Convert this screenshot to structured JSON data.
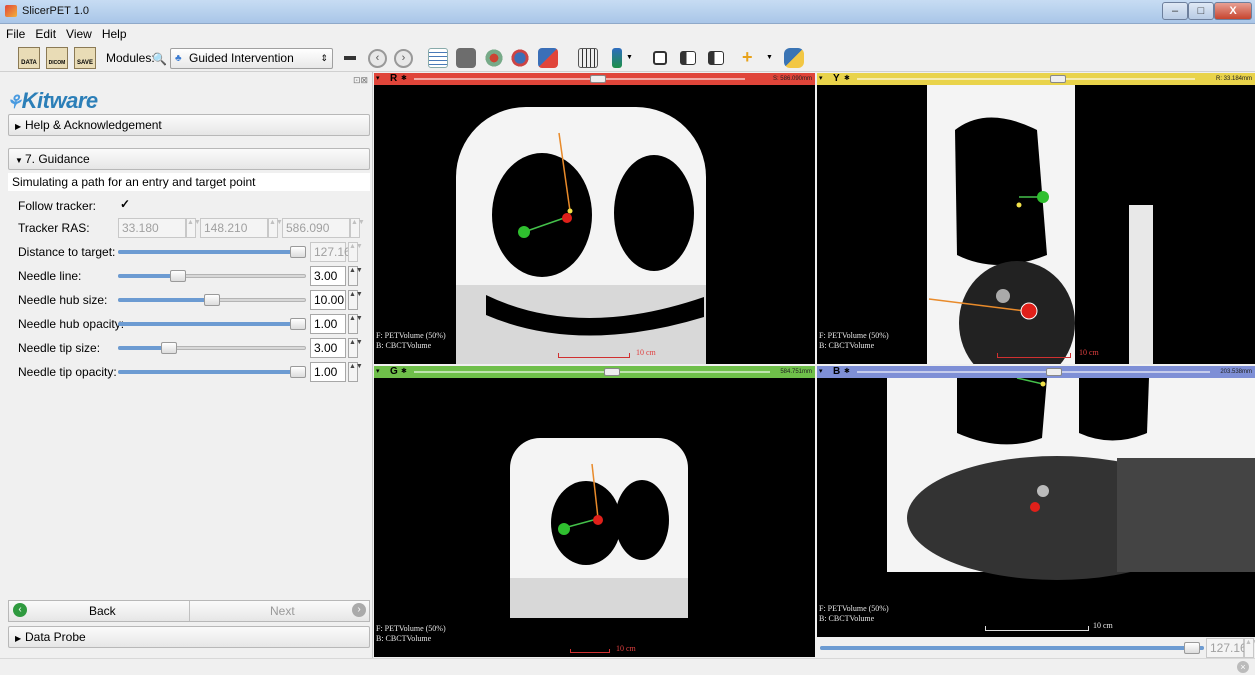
{
  "window": {
    "title": "SlicerPET 1.0",
    "minimize": "–",
    "maximize": "□",
    "close": "X"
  },
  "menu": [
    "File",
    "Edit",
    "View",
    "Help"
  ],
  "toolbar": {
    "load_data": "DATA",
    "load_dicom": "DICOM",
    "save": "SAVE",
    "modules_label": "Modules:",
    "module_selected": "Guided Intervention PETCT",
    "colors": {
      "accent": "#3b7bd1",
      "python": "#f2c744"
    }
  },
  "left_panel": {
    "logo": "Kitware",
    "help_section": "Help & Acknowledgement",
    "step_section": "7. Guidance",
    "step_description": "Simulating a path for an entry and target point",
    "follow_tracker_label": "Follow tracker:",
    "follow_tracker_checked": "✓",
    "tracker_ras_label": "Tracker RAS:",
    "tracker_ras": [
      "33.180",
      "148.210",
      "586.090"
    ],
    "controls": [
      {
        "label": "Distance to target:",
        "value": "127.16",
        "level": 1.0,
        "disabled": true
      },
      {
        "label": "Needle line:",
        "value": "3.00",
        "level": 0.3,
        "disabled": false
      },
      {
        "label": "Needle hub size:",
        "value": "10.00",
        "level": 0.5,
        "disabled": false
      },
      {
        "label": "Needle hub opacity:",
        "value": "1.00",
        "level": 1.0,
        "disabled": false
      },
      {
        "label": "Needle tip size:",
        "value": "3.00",
        "level": 0.25,
        "disabled": false
      },
      {
        "label": "Needle tip opacity:",
        "value": "1.00",
        "level": 1.0,
        "disabled": false
      }
    ],
    "back_label": "Back",
    "next_label": "Next",
    "data_probe": "Data Probe"
  },
  "views": {
    "red": {
      "label": "R",
      "value": "S: 586.090mm",
      "slider": 0.56,
      "color": "#e0453a",
      "fg": "F: PETVolume (50%)",
      "bg": "B: CBCTVolume",
      "ruler": "10 cm"
    },
    "yellow": {
      "label": "Y",
      "value": "R: 33.184mm",
      "slider": 0.6,
      "color": "#e9d34a",
      "fg": "F: PETVolume (50%)",
      "bg": "B: CBCTVolume",
      "ruler": "10 cm"
    },
    "green": {
      "label": "G",
      "value": "584.751mm",
      "slider": 0.56,
      "color": "#6fbf4a",
      "fg": "F: PETVolume (50%)",
      "bg": "B: CBCTVolume",
      "ruler": "10 cm"
    },
    "blue": {
      "label": "B",
      "value": "203.538mm",
      "slider": 0.56,
      "color": "#7e8fd6",
      "fg": "F: PETVolume (50%)",
      "bg": "B: CBCTVolume",
      "ruler": "10 cm"
    }
  },
  "bottom_slider_value": "127.16"
}
